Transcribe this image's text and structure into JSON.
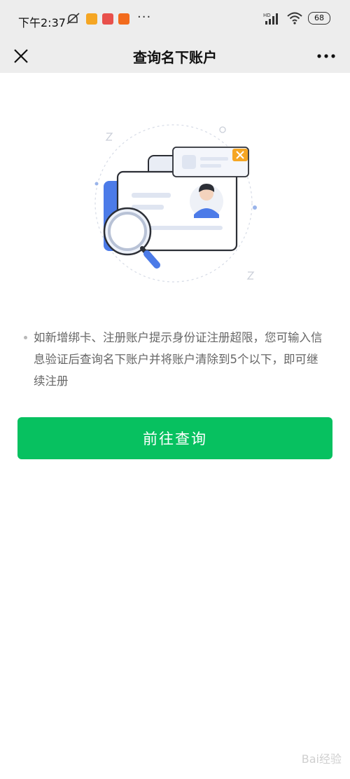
{
  "status_bar": {
    "time": "下午2:37",
    "dots": "···",
    "network": "HD",
    "battery": "68"
  },
  "nav": {
    "title": "查询名下账户",
    "close_icon": "close-icon",
    "more_icon": "more-icon"
  },
  "notice": {
    "text": "如新增绑卡、注册账户提示身份证注册超限，您可输入信息验证后查询名下账户并将账户清除到5个以下，即可继续注册"
  },
  "button": {
    "label": "前往查询"
  },
  "watermark": {
    "text": "Bai经验"
  },
  "colors": {
    "accent": "#07c160",
    "header_bg": "#ededed"
  }
}
